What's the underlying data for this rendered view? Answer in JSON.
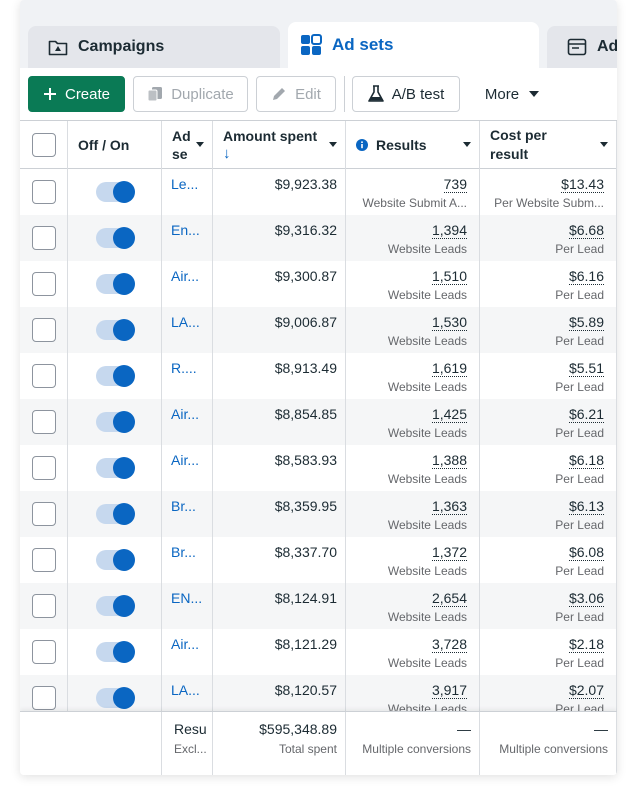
{
  "tabs": [
    {
      "label": "Campaigns",
      "icon": "campaign-folder-icon"
    },
    {
      "label": "Ad sets",
      "icon": "ad-sets-grid-icon"
    },
    {
      "label": "Ads",
      "icon": "ads-window-icon"
    }
  ],
  "toolbar": {
    "create_label": "Create",
    "duplicate_label": "Duplicate",
    "edit_label": "Edit",
    "ab_test_label": "A/B test",
    "more_label": "More"
  },
  "table": {
    "headers": {
      "off_on": "Off / On",
      "ad_set_line1": "Ad",
      "ad_set_line2": "se",
      "amount_spent": "Amount spent",
      "sort_arrow": "↓",
      "results": "Results",
      "cost_line1": "Cost per",
      "cost_line2": "result"
    },
    "rows": [
      {
        "name": "Le...",
        "amount": "$9,923.38",
        "results": "739",
        "results_sub": "Website Submit A...",
        "cost": "$13.43",
        "cost_sub": "Per Website Subm..."
      },
      {
        "name": "En...",
        "amount": "$9,316.32",
        "results": "1,394",
        "results_sub": "Website Leads",
        "cost": "$6.68",
        "cost_sub": "Per Lead"
      },
      {
        "name": "Air...",
        "amount": "$9,300.87",
        "results": "1,510",
        "results_sub": "Website Leads",
        "cost": "$6.16",
        "cost_sub": "Per Lead"
      },
      {
        "name": "LA...",
        "amount": "$9,006.87",
        "results": "1,530",
        "results_sub": "Website Leads",
        "cost": "$5.89",
        "cost_sub": "Per Lead"
      },
      {
        "name": "R....",
        "amount": "$8,913.49",
        "results": "1,619",
        "results_sub": "Website Leads",
        "cost": "$5.51",
        "cost_sub": "Per Lead"
      },
      {
        "name": "Air...",
        "amount": "$8,854.85",
        "results": "1,425",
        "results_sub": "Website Leads",
        "cost": "$6.21",
        "cost_sub": "Per Lead"
      },
      {
        "name": "Air...",
        "amount": "$8,583.93",
        "results": "1,388",
        "results_sub": "Website Leads",
        "cost": "$6.18",
        "cost_sub": "Per Lead"
      },
      {
        "name": "Br...",
        "amount": "$8,359.95",
        "results": "1,363",
        "results_sub": "Website Leads",
        "cost": "$6.13",
        "cost_sub": "Per Lead"
      },
      {
        "name": "Br...",
        "amount": "$8,337.70",
        "results": "1,372",
        "results_sub": "Website Leads",
        "cost": "$6.08",
        "cost_sub": "Per Lead"
      },
      {
        "name": "EN...",
        "amount": "$8,124.91",
        "results": "2,654",
        "results_sub": "Website Leads",
        "cost": "$3.06",
        "cost_sub": "Per Lead"
      },
      {
        "name": "Air...",
        "amount": "$8,121.29",
        "results": "3,728",
        "results_sub": "Website Leads",
        "cost": "$2.18",
        "cost_sub": "Per Lead"
      },
      {
        "name": "LA...",
        "amount": "$8,120.57",
        "results": "3,917",
        "results_sub": "Website Leads",
        "cost": "$2.07",
        "cost_sub": "Per Lead"
      }
    ],
    "footer": {
      "name_main": "Resu",
      "name_sub": "Excl...",
      "amount": "$595,348.89",
      "amount_sub": "Total spent",
      "results": "—",
      "results_sub": "Multiple conversions",
      "cost": "—",
      "cost_sub": "Multiple conversions"
    }
  },
  "colors": {
    "accent": "#0a66c2",
    "create_green": "#0a7a55"
  }
}
